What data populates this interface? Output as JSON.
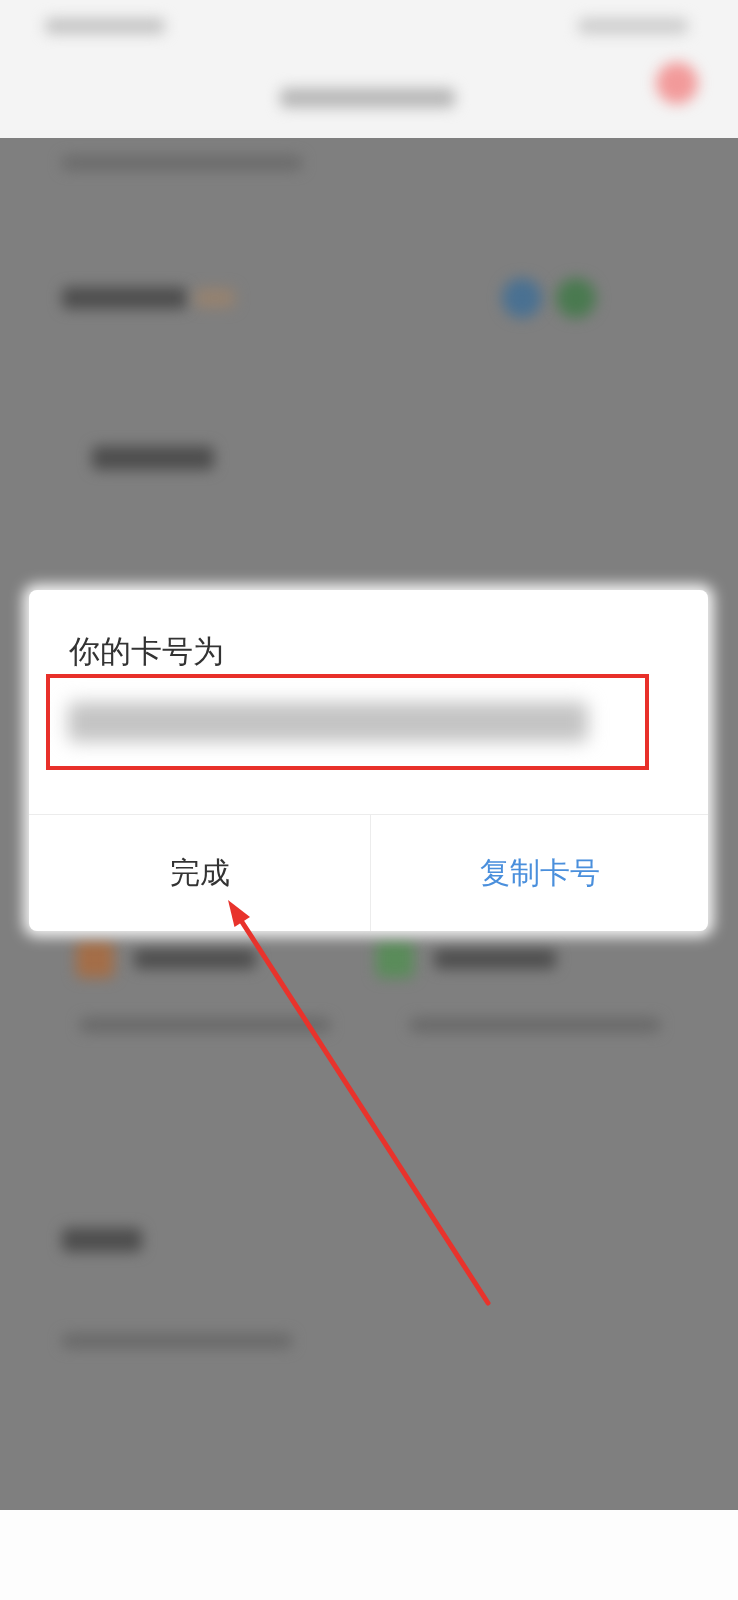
{
  "dialog": {
    "title": "你的卡号为",
    "card_number": {
      "highlighted": true
    },
    "buttons": [
      {
        "label": "完成",
        "kind": "default",
        "arrow_pointer": true
      },
      {
        "label": "复制卡号",
        "kind": "primary",
        "arrow_pointer": false
      }
    ]
  }
}
